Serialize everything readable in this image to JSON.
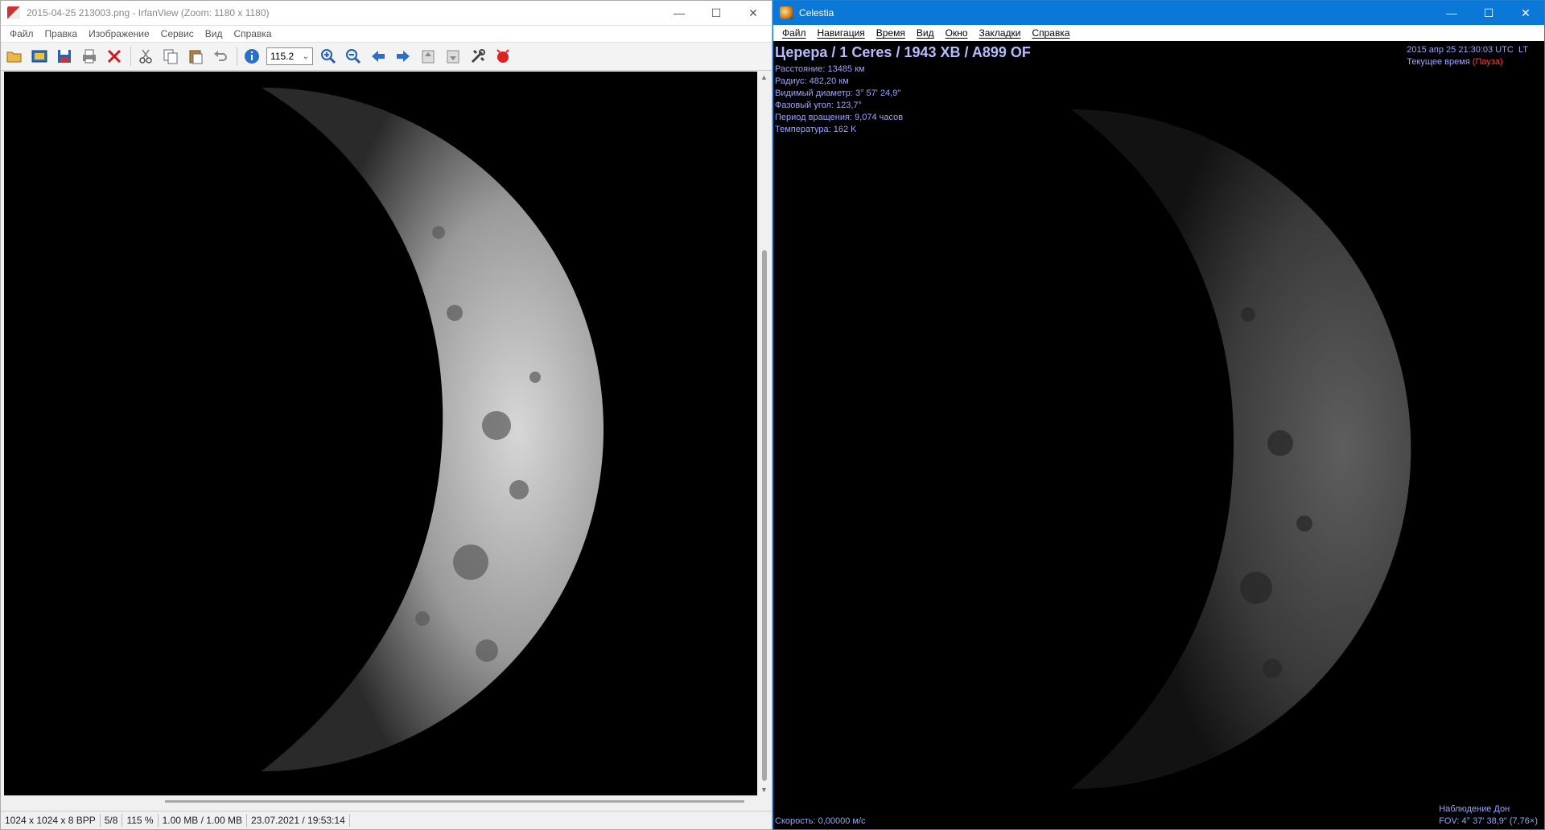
{
  "irfanview": {
    "title": "2015-04-25 213003.png - IrfanView (Zoom: 1180 x 1180)",
    "menu": [
      "Файл",
      "Правка",
      "Изображение",
      "Сервис",
      "Вид",
      "Справка"
    ],
    "toolbar": {
      "icons": [
        "open-folder-icon",
        "slideshow-icon",
        "save-icon",
        "print-icon",
        "delete-icon",
        "cut-icon",
        "copy-icon",
        "paste-icon",
        "undo-icon",
        "info-icon",
        "zoom-in-icon",
        "zoom-out-icon",
        "previous-icon",
        "next-icon",
        "first-icon",
        "last-icon",
        "settings-icon",
        "exit-icon"
      ],
      "zoom_value": "115.2"
    },
    "status": {
      "dimensions": "1024 x 1024 x 8 BPP",
      "index": "5/8",
      "zoom": "115 %",
      "size": "1.00 MB / 1.00 MB",
      "datetime": "23.07.2021 / 19:53:14"
    },
    "window_controls": [
      "—",
      "☐",
      "✕"
    ]
  },
  "celestia": {
    "title": "Celestia",
    "menu": [
      "Файл",
      "Навигация",
      "Время",
      "Вид",
      "Окно",
      "Закладки",
      "Справка"
    ],
    "object_name": "Церера / 1 Ceres / 1943 XB / A899 OF",
    "stats": {
      "distance": "Расстояние: 13485 км",
      "radius": "Радиус: 482,20 км",
      "apparent_diameter": "Видимый диаметр: 3° 57' 24,9\"",
      "phase_angle": "Фазовый угол: 123,7°",
      "rotation_period": "Период вращения: 9,074 часов",
      "temperature": "Температура: 162 K"
    },
    "time": {
      "datetime": "2015 апр 25 21:30:03 UTC",
      "lt": "LT",
      "label": "Текущее время",
      "paused": "(Пауза)"
    },
    "speed": "Скорость: 0,00000 м/с",
    "observer": "Наблюдение Дон",
    "fov": "FOV: 4° 37' 38,9\" (7,76×)",
    "window_controls": [
      "—",
      "☐",
      "✕"
    ]
  },
  "colors": {
    "celestia_titlebar": "#0b78d7",
    "hud_text": "#9aa6ff",
    "paused": "#ff4040"
  }
}
